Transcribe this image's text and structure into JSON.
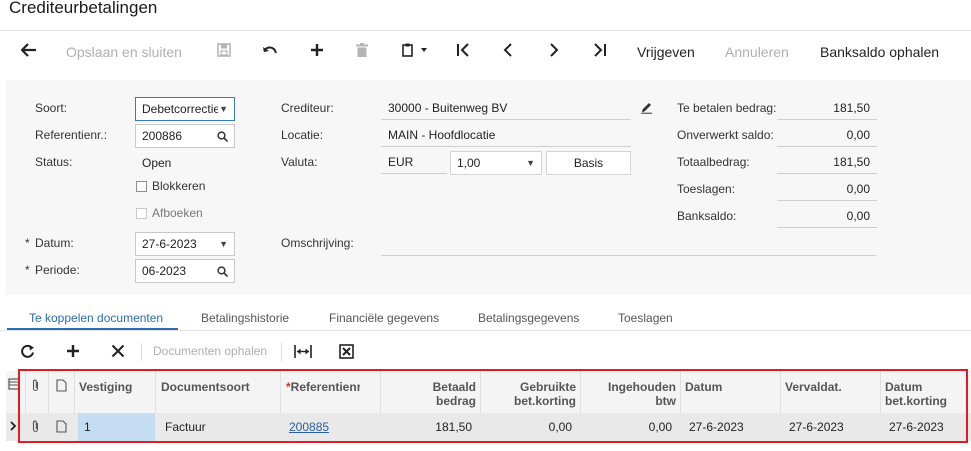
{
  "app": {
    "title": "Crediteurbetalingen"
  },
  "toolbar": {
    "back_icon": "arrow-left-icon",
    "save_close_label": "Opslaan en sluiten",
    "save_icon": "floppy-disk-icon",
    "undo_icon": "undo-icon",
    "add_icon": "plus-icon",
    "delete_icon": "trash-icon",
    "copy_paste_icon": "clipboard-icon",
    "first_icon": "first-record-icon",
    "prev_icon": "chevron-left-icon",
    "next_icon": "chevron-right-icon",
    "last_icon": "last-record-icon",
    "release_label": "Vrijgeven",
    "cancel_label": "Annuleren",
    "bank_balance_label": "Banksaldo ophalen"
  },
  "form": {
    "type_label": "Soort:",
    "type_value": "Debetcorrectie",
    "ref_label": "Referentienr.:",
    "ref_value": "200886",
    "status_label": "Status:",
    "status_value": "Open",
    "hold_label": "Blokkeren",
    "approve_label": "Afboeken",
    "date_label": "Datum:",
    "date_value": "27-6-2023",
    "period_label": "Periode:",
    "period_value": "06-2023",
    "vendor_label": "Crediteur:",
    "vendor_value": "30000 - Buitenweg BV",
    "location_label": "Locatie:",
    "location_value": "MAIN - Hoofdlocatie",
    "currency_label": "Valuta:",
    "currency_value": "EUR",
    "rate_value": "1,00",
    "base_label": "Basis",
    "description_label": "Omschrijving:",
    "amount_to_pay_label": "Te betalen bedrag:",
    "amount_to_pay_value": "181,50",
    "unapplied_label": "Onverwerkt saldo:",
    "unapplied_value": "0,00",
    "total_label": "Totaalbedrag:",
    "total_value": "181,50",
    "charges_label": "Toeslagen:",
    "charges_value": "0,00",
    "bank_balance_label": "Banksaldo:",
    "bank_balance_value": "0,00",
    "required_mark": "*"
  },
  "tabs": [
    {
      "label": "Te koppelen documenten"
    },
    {
      "label": "Betalingshistorie"
    },
    {
      "label": "Financiële gegevens"
    },
    {
      "label": "Betalingsgegevens"
    },
    {
      "label": "Toeslagen"
    }
  ],
  "grid_toolbar": {
    "refresh_icon": "refresh-icon",
    "add_icon": "plus-icon",
    "delete_icon": "close-icon",
    "load_docs_label": "Documenten ophalen",
    "fit_icon": "fit-columns-icon",
    "excel_icon": "excel-export-icon"
  },
  "grid": {
    "columns": [
      {
        "label": "Vestiging"
      },
      {
        "label": "Documentsoort"
      },
      {
        "label": "Referentienr."
      },
      {
        "label": "Betaald",
        "label2": "bedrag"
      },
      {
        "label": "Gebruikte",
        "label2": "bet.korting"
      },
      {
        "label": "Ingehouden",
        "label2": "btw"
      },
      {
        "label": "Datum"
      },
      {
        "label": "Vervaldat."
      },
      {
        "label": "Datum",
        "label2": "bet.korting"
      }
    ],
    "rows": [
      {
        "branch": "1",
        "doc_type": "Factuur",
        "ref": "200885",
        "paid_amount": "181,50",
        "discount_used": "0,00",
        "tax_withheld": "0,00",
        "date": "27-6-2023",
        "due_date": "27-6-2023",
        "discount_date": "27-6-2023"
      }
    ]
  },
  "colors": {
    "accent": "#2b6cb3",
    "highlight_border": "#e01b24",
    "selected_cell": "#c5ddf3"
  }
}
